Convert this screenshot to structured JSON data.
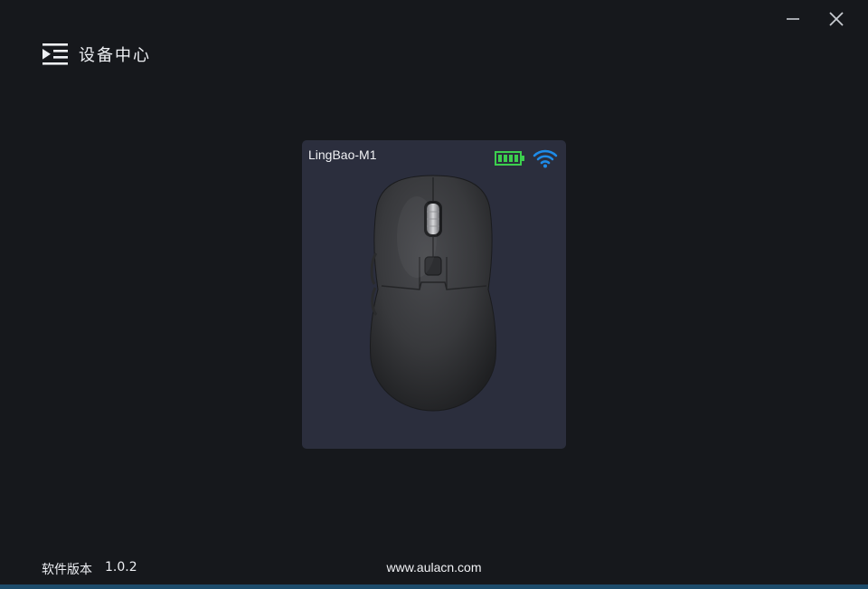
{
  "header": {
    "title": "设备中心",
    "icon": "menu-collapse-icon"
  },
  "window_controls": {
    "minimize_icon": "minimize-icon",
    "close_icon": "close-icon"
  },
  "device": {
    "name": "LingBao-M1",
    "battery_color": "#3ccf4e",
    "wifi_color": "#1e8be8",
    "image": "mouse-image"
  },
  "footer": {
    "version_label": "软件版本",
    "version": "1.0.2",
    "url": "www.aulacn.com"
  },
  "colors": {
    "background": "#16181c",
    "card": "#2b2e3d"
  }
}
